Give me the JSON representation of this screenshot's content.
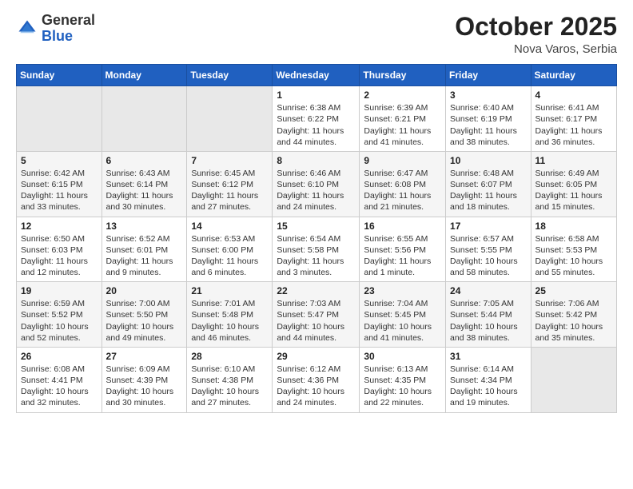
{
  "header": {
    "logo": {
      "general": "General",
      "blue": "Blue"
    },
    "title": "October 2025",
    "location": "Nova Varos, Serbia"
  },
  "days_of_week": [
    "Sunday",
    "Monday",
    "Tuesday",
    "Wednesday",
    "Thursday",
    "Friday",
    "Saturday"
  ],
  "weeks": [
    [
      {
        "day": "",
        "sunrise": "",
        "sunset": "",
        "daylight": ""
      },
      {
        "day": "",
        "sunrise": "",
        "sunset": "",
        "daylight": ""
      },
      {
        "day": "",
        "sunrise": "",
        "sunset": "",
        "daylight": ""
      },
      {
        "day": "1",
        "sunrise": "6:38 AM",
        "sunset": "6:22 PM",
        "daylight": "11 hours and 44 minutes."
      },
      {
        "day": "2",
        "sunrise": "6:39 AM",
        "sunset": "6:21 PM",
        "daylight": "11 hours and 41 minutes."
      },
      {
        "day": "3",
        "sunrise": "6:40 AM",
        "sunset": "6:19 PM",
        "daylight": "11 hours and 38 minutes."
      },
      {
        "day": "4",
        "sunrise": "6:41 AM",
        "sunset": "6:17 PM",
        "daylight": "11 hours and 36 minutes."
      }
    ],
    [
      {
        "day": "5",
        "sunrise": "6:42 AM",
        "sunset": "6:15 PM",
        "daylight": "11 hours and 33 minutes."
      },
      {
        "day": "6",
        "sunrise": "6:43 AM",
        "sunset": "6:14 PM",
        "daylight": "11 hours and 30 minutes."
      },
      {
        "day": "7",
        "sunrise": "6:45 AM",
        "sunset": "6:12 PM",
        "daylight": "11 hours and 27 minutes."
      },
      {
        "day": "8",
        "sunrise": "6:46 AM",
        "sunset": "6:10 PM",
        "daylight": "11 hours and 24 minutes."
      },
      {
        "day": "9",
        "sunrise": "6:47 AM",
        "sunset": "6:08 PM",
        "daylight": "11 hours and 21 minutes."
      },
      {
        "day": "10",
        "sunrise": "6:48 AM",
        "sunset": "6:07 PM",
        "daylight": "11 hours and 18 minutes."
      },
      {
        "day": "11",
        "sunrise": "6:49 AM",
        "sunset": "6:05 PM",
        "daylight": "11 hours and 15 minutes."
      }
    ],
    [
      {
        "day": "12",
        "sunrise": "6:50 AM",
        "sunset": "6:03 PM",
        "daylight": "11 hours and 12 minutes."
      },
      {
        "day": "13",
        "sunrise": "6:52 AM",
        "sunset": "6:01 PM",
        "daylight": "11 hours and 9 minutes."
      },
      {
        "day": "14",
        "sunrise": "6:53 AM",
        "sunset": "6:00 PM",
        "daylight": "11 hours and 6 minutes."
      },
      {
        "day": "15",
        "sunrise": "6:54 AM",
        "sunset": "5:58 PM",
        "daylight": "11 hours and 3 minutes."
      },
      {
        "day": "16",
        "sunrise": "6:55 AM",
        "sunset": "5:56 PM",
        "daylight": "11 hours and 1 minute."
      },
      {
        "day": "17",
        "sunrise": "6:57 AM",
        "sunset": "5:55 PM",
        "daylight": "10 hours and 58 minutes."
      },
      {
        "day": "18",
        "sunrise": "6:58 AM",
        "sunset": "5:53 PM",
        "daylight": "10 hours and 55 minutes."
      }
    ],
    [
      {
        "day": "19",
        "sunrise": "6:59 AM",
        "sunset": "5:52 PM",
        "daylight": "10 hours and 52 minutes."
      },
      {
        "day": "20",
        "sunrise": "7:00 AM",
        "sunset": "5:50 PM",
        "daylight": "10 hours and 49 minutes."
      },
      {
        "day": "21",
        "sunrise": "7:01 AM",
        "sunset": "5:48 PM",
        "daylight": "10 hours and 46 minutes."
      },
      {
        "day": "22",
        "sunrise": "7:03 AM",
        "sunset": "5:47 PM",
        "daylight": "10 hours and 44 minutes."
      },
      {
        "day": "23",
        "sunrise": "7:04 AM",
        "sunset": "5:45 PM",
        "daylight": "10 hours and 41 minutes."
      },
      {
        "day": "24",
        "sunrise": "7:05 AM",
        "sunset": "5:44 PM",
        "daylight": "10 hours and 38 minutes."
      },
      {
        "day": "25",
        "sunrise": "7:06 AM",
        "sunset": "5:42 PM",
        "daylight": "10 hours and 35 minutes."
      }
    ],
    [
      {
        "day": "26",
        "sunrise": "6:08 AM",
        "sunset": "4:41 PM",
        "daylight": "10 hours and 32 minutes."
      },
      {
        "day": "27",
        "sunrise": "6:09 AM",
        "sunset": "4:39 PM",
        "daylight": "10 hours and 30 minutes."
      },
      {
        "day": "28",
        "sunrise": "6:10 AM",
        "sunset": "4:38 PM",
        "daylight": "10 hours and 27 minutes."
      },
      {
        "day": "29",
        "sunrise": "6:12 AM",
        "sunset": "4:36 PM",
        "daylight": "10 hours and 24 minutes."
      },
      {
        "day": "30",
        "sunrise": "6:13 AM",
        "sunset": "4:35 PM",
        "daylight": "10 hours and 22 minutes."
      },
      {
        "day": "31",
        "sunrise": "6:14 AM",
        "sunset": "4:34 PM",
        "daylight": "10 hours and 19 minutes."
      },
      {
        "day": "",
        "sunrise": "",
        "sunset": "",
        "daylight": ""
      }
    ]
  ],
  "labels": {
    "sunrise": "Sunrise:",
    "sunset": "Sunset:",
    "daylight": "Daylight:"
  }
}
